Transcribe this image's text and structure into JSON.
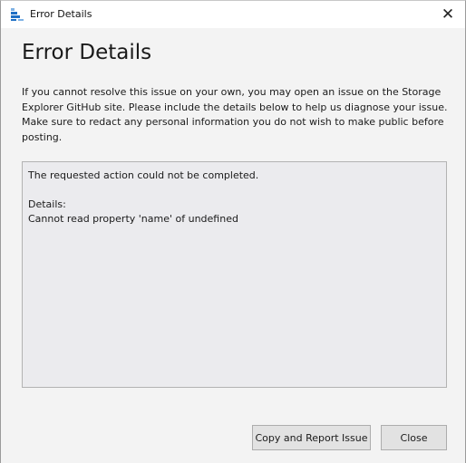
{
  "window": {
    "title": "Error Details",
    "close_glyph": "✕",
    "app_icon": "storage-explorer-icon"
  },
  "content": {
    "heading": "Error Details",
    "intro": "If you cannot resolve this issue on your own, you may open an issue on the Storage Explorer GitHub site. Please include the details below to help us diagnose your issue. Make sure to redact any personal information you do not wish to make public before posting.",
    "details": {
      "message": "The requested action could not be completed.",
      "details_label": "Details:",
      "error": "Cannot read property 'name' of undefined"
    }
  },
  "buttons": {
    "copy_report": "Copy and Report Issue",
    "close": "Close"
  },
  "colors": {
    "icon_blue": "#1f6fc5",
    "icon_light": "#7fb2e5"
  }
}
